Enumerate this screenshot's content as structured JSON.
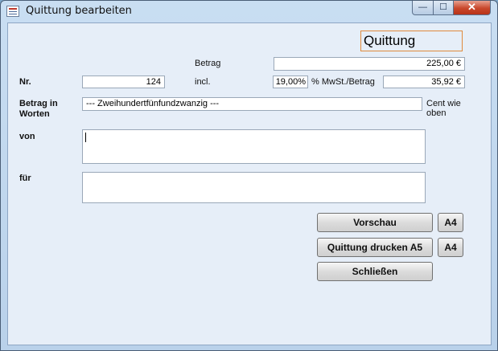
{
  "window": {
    "title": "Quittung bearbeiten",
    "minimize_glyph": "—",
    "maximize_glyph": "☐",
    "close_glyph": "✕"
  },
  "form": {
    "heading": "Quittung",
    "betrag_label": "Betrag",
    "betrag_value": "225,00 €",
    "nr_label": "Nr.",
    "nr_value": "124",
    "incl_label": "incl.",
    "mwst_rate": "19,00%",
    "mwst_label": "% MwSt./Betrag",
    "mwst_value": "35,92 €",
    "worte_label": "Betrag in Worten",
    "worte_value": "--- Zweihundertfünfundzwanzig ---",
    "cent_label": "Cent wie oben",
    "von_label": "von",
    "von_value": "",
    "fuer_label": "für",
    "fuer_value": ""
  },
  "buttons": {
    "vorschau": "Vorschau",
    "vorschau_a4": "A4",
    "drucken": "Quittung drucken A5",
    "drucken_a4": "A4",
    "schliessen": "Schließen"
  }
}
